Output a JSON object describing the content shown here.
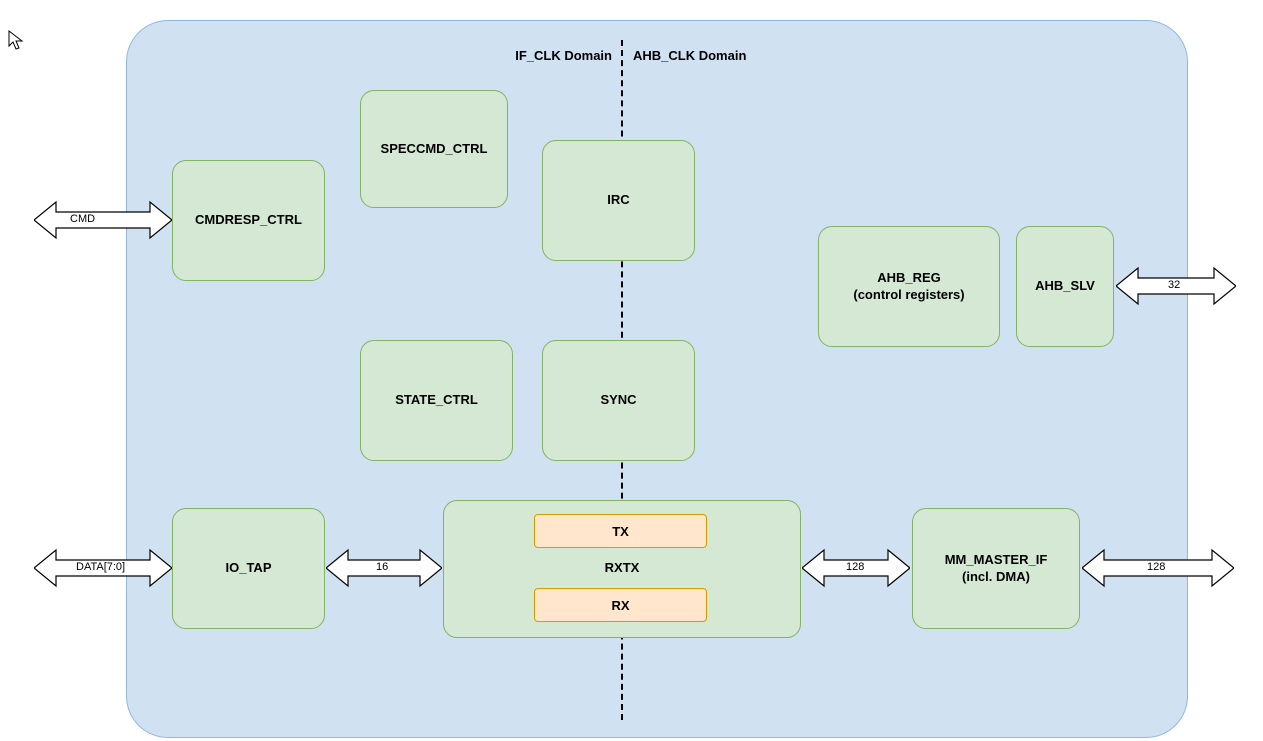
{
  "domains": {
    "left_label": "IF_CLK Domain",
    "right_label": "AHB_CLK Domain"
  },
  "blocks": {
    "cmdresp_ctrl": "CMDRESP_CTRL",
    "speccmd_ctrl": "SPECCMD_CTRL",
    "irc": "IRC",
    "state_ctrl": "STATE_CTRL",
    "sync": "SYNC",
    "ahb_reg": "AHB_REG\n(control registers)",
    "ahb_slv": "AHB_SLV",
    "io_tap": "IO_TAP",
    "rxtx": "RXTX",
    "tx": "TX",
    "rx": "RX",
    "mm_master_if": "MM_MASTER_IF\n(incl. DMA)"
  },
  "arrows": {
    "cmd": "CMD",
    "data": "DATA[7:0]",
    "io_rxtx": "16",
    "rxtx_mm": "128",
    "mm_out": "128",
    "ahb_slv_out": "32"
  }
}
